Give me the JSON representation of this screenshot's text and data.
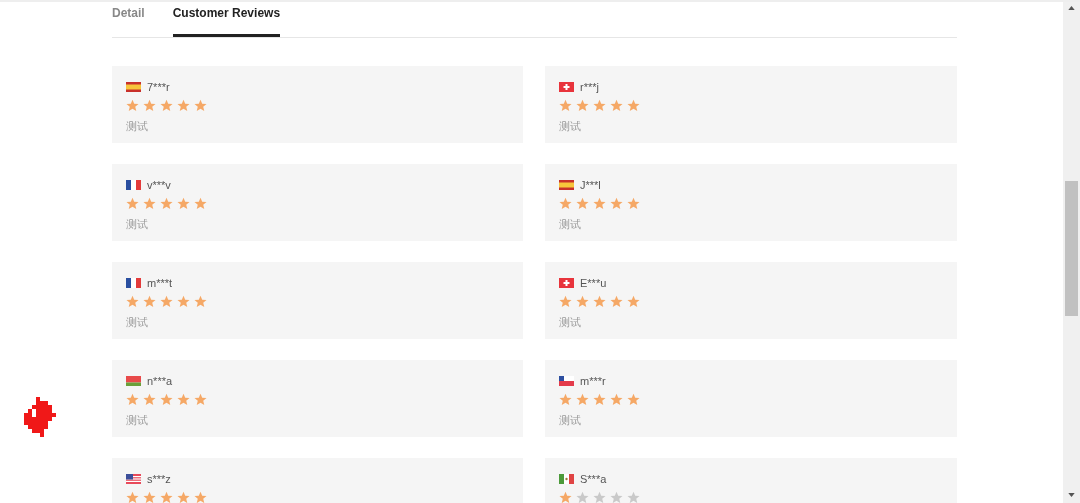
{
  "tabs": [
    {
      "label": "Detail",
      "selected": false
    },
    {
      "label": "Customer Reviews",
      "selected": true
    }
  ],
  "reviews": [
    {
      "kind": "es",
      "name": "7***r",
      "stars": 5,
      "text": "测试"
    },
    {
      "kind": "ch",
      "name": "r***j",
      "stars": 5,
      "text": "测试"
    },
    {
      "kind": "fr",
      "name": "v***v",
      "stars": 5,
      "text": "测试"
    },
    {
      "kind": "es",
      "name": "J***l",
      "stars": 5,
      "text": "测试"
    },
    {
      "kind": "fr",
      "name": "m***t",
      "stars": 5,
      "text": "测试"
    },
    {
      "kind": "ch",
      "name": "E***u",
      "stars": 5,
      "text": "测试"
    },
    {
      "kind": "by",
      "name": "n***a",
      "stars": 5,
      "text": "测试"
    },
    {
      "kind": "cl",
      "name": "m***r",
      "stars": 5,
      "text": "测试"
    },
    {
      "kind": "us",
      "name": "s***z",
      "stars": 5
    },
    {
      "kind": "mx",
      "name": "S***a",
      "stars": 1
    }
  ]
}
